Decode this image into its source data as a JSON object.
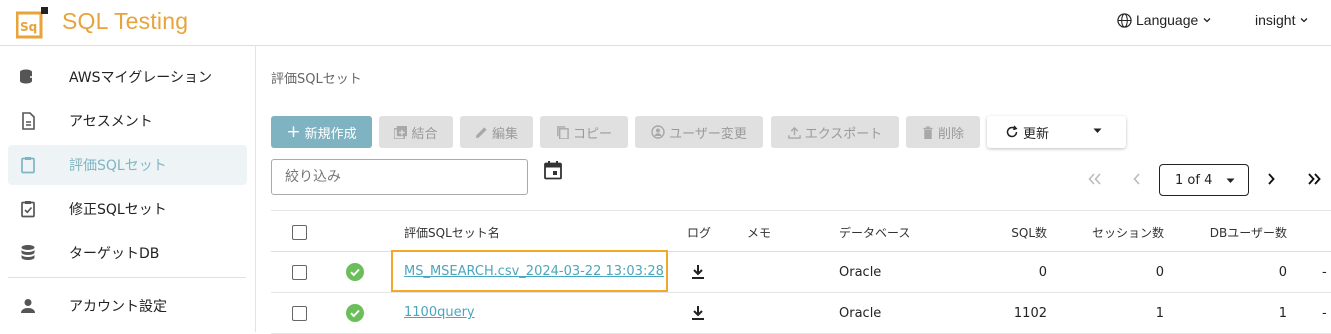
{
  "header": {
    "title": "SQL Testing",
    "logo_text": "Sq",
    "language_label": "Language",
    "user_label": "insight",
    "brand_color": "#e8a33a"
  },
  "sidebar": {
    "items": [
      {
        "label": "AWSマイグレーション",
        "icon": "database-migrate-icon"
      },
      {
        "label": "アセスメント",
        "icon": "document-icon"
      },
      {
        "label": "評価SQLセット",
        "icon": "clipboard-icon",
        "active": true
      },
      {
        "label": "修正SQLセット",
        "icon": "clipboard-check-icon"
      },
      {
        "label": "ターゲットDB",
        "icon": "database-icon"
      },
      {
        "label": "アカウント設定",
        "icon": "person-icon"
      }
    ]
  },
  "main": {
    "breadcrumb": "評価SQLセット",
    "toolbar": {
      "new": "新規作成",
      "merge": "結合",
      "edit": "編集",
      "copy": "コピー",
      "change_user": "ユーザー変更",
      "export": "エクスポート",
      "delete": "削除",
      "refresh": "更新"
    },
    "filter": {
      "placeholder": "絞り込み"
    },
    "pagination": {
      "label": "1 of 4"
    },
    "table": {
      "headers": {
        "name": "評価SQLセット名",
        "log": "ログ",
        "memo": "メモ",
        "database": "データベース",
        "sql_count": "SQL数",
        "session_count": "セッション数",
        "db_user_count": "DBユーザー数"
      },
      "rows": [
        {
          "name": "MS_MSEARCH.csv_2024-03-22 13:03:28",
          "database": "Oracle",
          "sql_count": "0",
          "session_count": "0",
          "db_user_count": "0",
          "trailing": "-"
        },
        {
          "name": "1100query",
          "database": "Oracle",
          "sql_count": "1102",
          "session_count": "1",
          "db_user_count": "1",
          "trailing": "-"
        }
      ]
    }
  }
}
